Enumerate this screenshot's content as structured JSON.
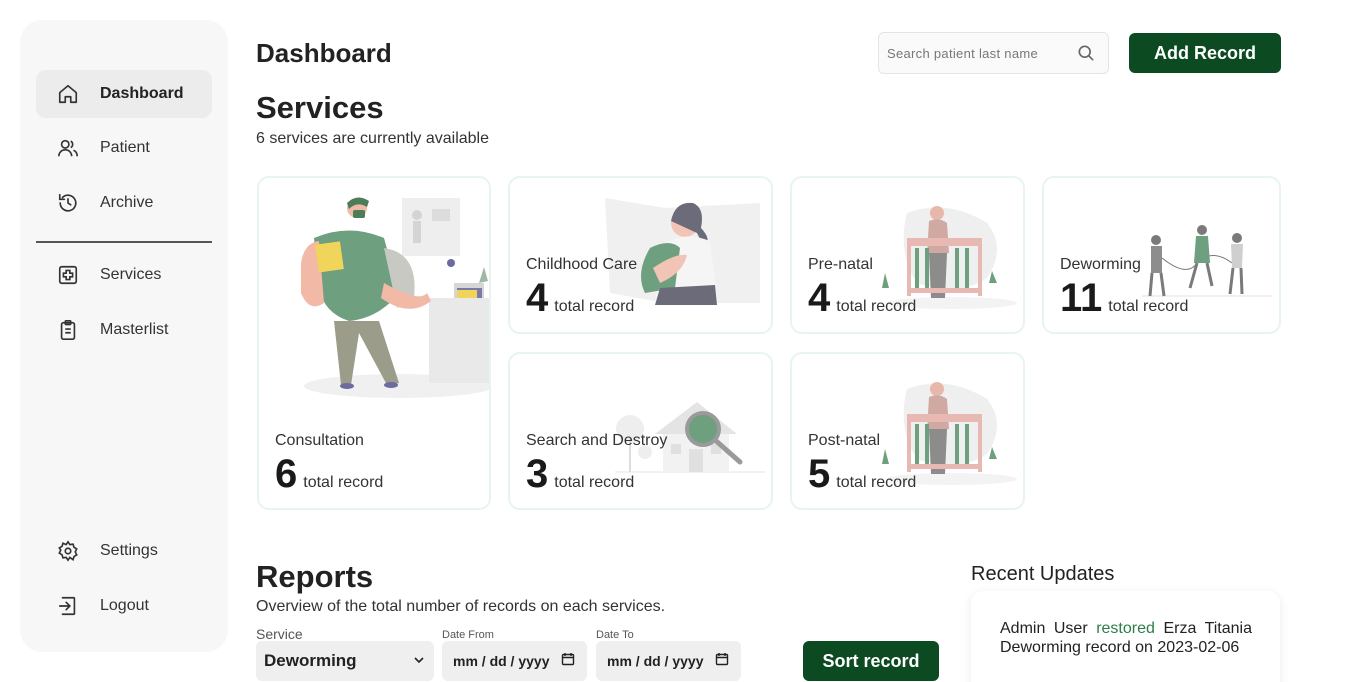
{
  "sidebar": {
    "items": [
      {
        "label": "Dashboard",
        "icon": "home-icon",
        "active": true
      },
      {
        "label": "Patient",
        "icon": "users-icon"
      },
      {
        "label": "Archive",
        "icon": "history-icon"
      },
      {
        "label": "Services",
        "icon": "medical-plus-icon"
      },
      {
        "label": "Masterlist",
        "icon": "clipboard-icon"
      },
      {
        "label": "Settings",
        "icon": "gear-icon"
      },
      {
        "label": "Logout",
        "icon": "logout-icon"
      }
    ]
  },
  "header": {
    "title": "Dashboard",
    "search_placeholder": "Search patient last name",
    "add_label": "Add Record"
  },
  "services": {
    "title": "Services",
    "subtitle": "6 services are currently available",
    "unit": "total record",
    "cards": [
      {
        "name": "Consultation",
        "count": "6"
      },
      {
        "name": "Childhood Care",
        "count": "4"
      },
      {
        "name": "Pre-natal",
        "count": "4"
      },
      {
        "name": "Deworming",
        "count": "11"
      },
      {
        "name": "Search and Destroy",
        "count": "3"
      },
      {
        "name": "Post-natal",
        "count": "5"
      }
    ]
  },
  "reports": {
    "title": "Reports",
    "subtitle": "Overview of the total number of records on each services.",
    "service_label": "Service",
    "service_value": "Deworming",
    "date_from_label": "Date From",
    "date_from_value": "mm / dd / yyyy",
    "date_to_label": "Date To",
    "date_to_value": "mm / dd / yyyy",
    "sort_label": "Sort record"
  },
  "recent": {
    "title": "Recent Updates",
    "entries": [
      {
        "user": "Admin User",
        "action": "restored",
        "text": "Erza Titania Deworming record on 2023-02-06"
      }
    ]
  },
  "colors": {
    "accent": "#0c4a22",
    "card_border": "#e6f5ee",
    "sidebar_bg": "#f7f7f7",
    "illustration_green": "#6e9f7e"
  }
}
